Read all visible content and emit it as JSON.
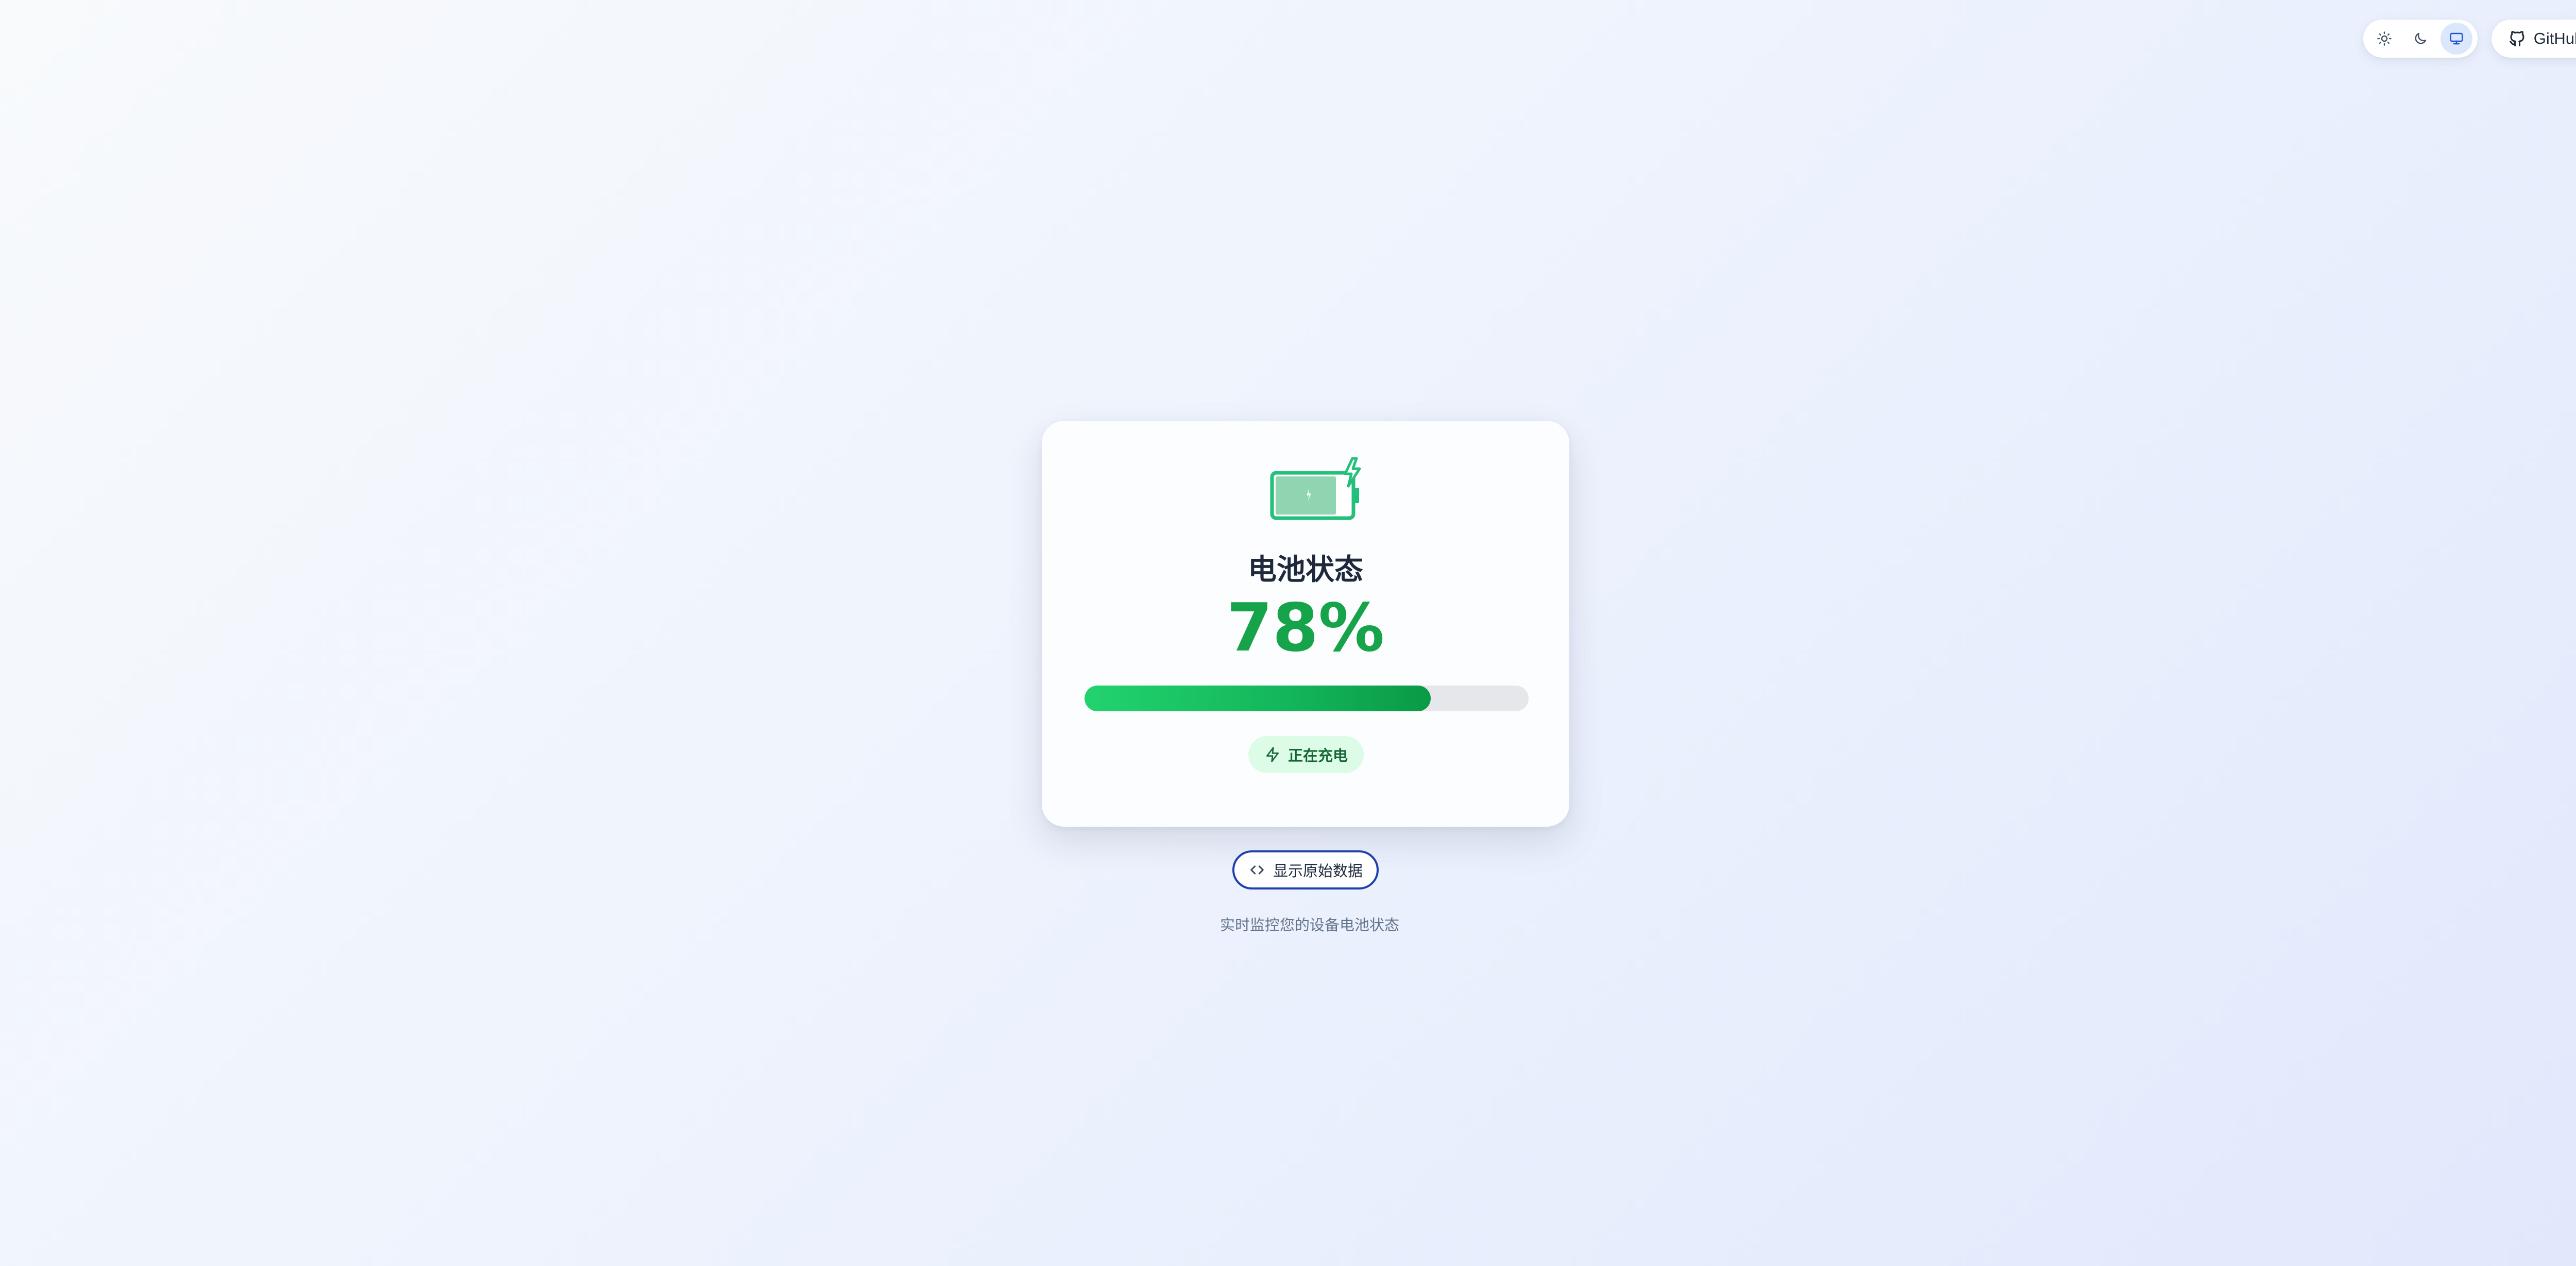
{
  "theme_switcher": {
    "options": [
      {
        "icon": "sun-icon",
        "selected": false
      },
      {
        "icon": "moon-icon",
        "selected": false
      },
      {
        "icon": "monitor-icon",
        "selected": true
      }
    ]
  },
  "github": {
    "label": "GitHub",
    "icon": "github-icon"
  },
  "battery": {
    "title": "电池状态",
    "percent_label": "78%",
    "level": 0.78,
    "charging": true,
    "status_label": "正在充电",
    "icon": "battery-charging-icon",
    "colors": {
      "accent": "#16a34a",
      "badge_bg": "#dcfce7",
      "track": "#e5e7eb"
    }
  },
  "raw_data_button": {
    "label": "显示原始数据",
    "icon": "code-icon"
  },
  "footer": {
    "text": "实时监控您的设备电池状态"
  }
}
